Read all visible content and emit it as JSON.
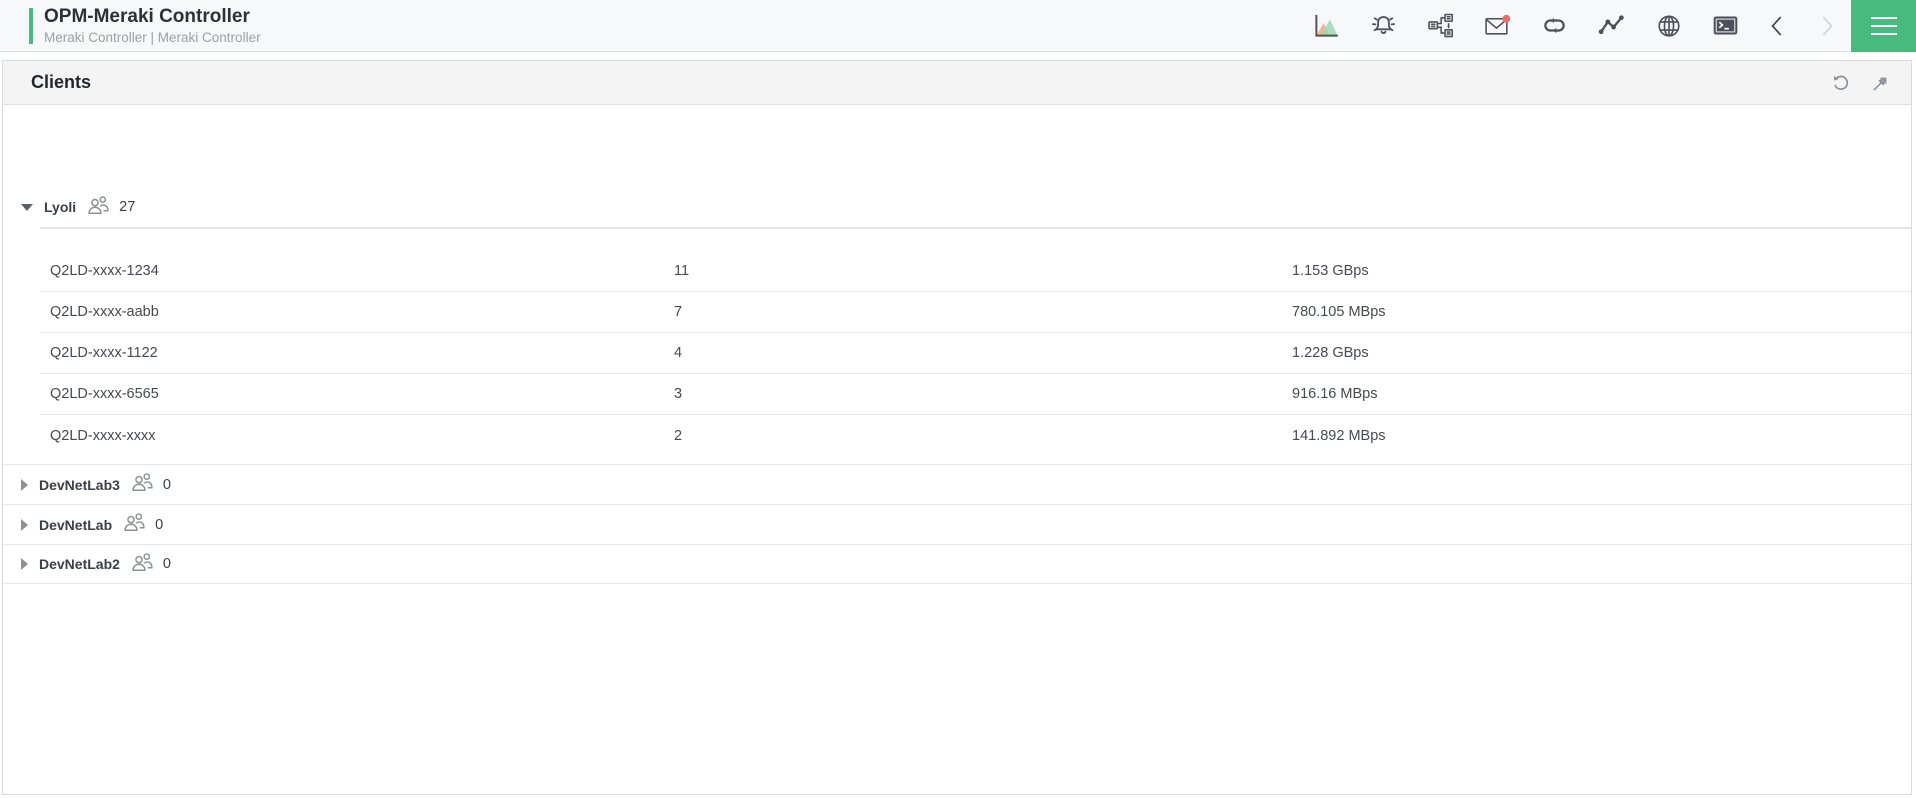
{
  "colors": {
    "accent_green": "#47bb7e",
    "badge_red": "#f26d64",
    "icon_dark": "#4a5158",
    "icon_gray": "#8a9097"
  },
  "header": {
    "title": "OPM-Meraki Controller",
    "subtitle": "Meraki Controller | Meraki Controller"
  },
  "toolbar": {
    "icons": [
      "area-chart",
      "alarm-bell",
      "workflow",
      "mail-unread",
      "link-loop",
      "line-graph",
      "globe",
      "terminal",
      "chevron-left",
      "chevron-right-disabled",
      "hamburger-menu"
    ]
  },
  "widget": {
    "title": "Clients",
    "actions": [
      "refresh",
      "pin"
    ]
  },
  "groups": [
    {
      "name": "Lyoli",
      "count": "27",
      "expanded": true,
      "clients": [
        {
          "name": "Q2LD-xxxx-1234",
          "value": "11",
          "usage": "1.153 GBps"
        },
        {
          "name": "Q2LD-xxxx-aabb",
          "value": "7",
          "usage": "780.105 MBps"
        },
        {
          "name": "Q2LD-xxxx-1122",
          "value": "4",
          "usage": "1.228 GBps"
        },
        {
          "name": "Q2LD-xxxx-6565",
          "value": "3",
          "usage": "916.16 MBps"
        },
        {
          "name": "Q2LD-xxxx-xxxx",
          "value": "2",
          "usage": "141.892 MBps"
        }
      ]
    },
    {
      "name": "DevNetLab3",
      "count": "0",
      "expanded": false
    },
    {
      "name": "DevNetLab",
      "count": "0",
      "expanded": false
    },
    {
      "name": "DevNetLab2",
      "count": "0",
      "expanded": false
    }
  ]
}
